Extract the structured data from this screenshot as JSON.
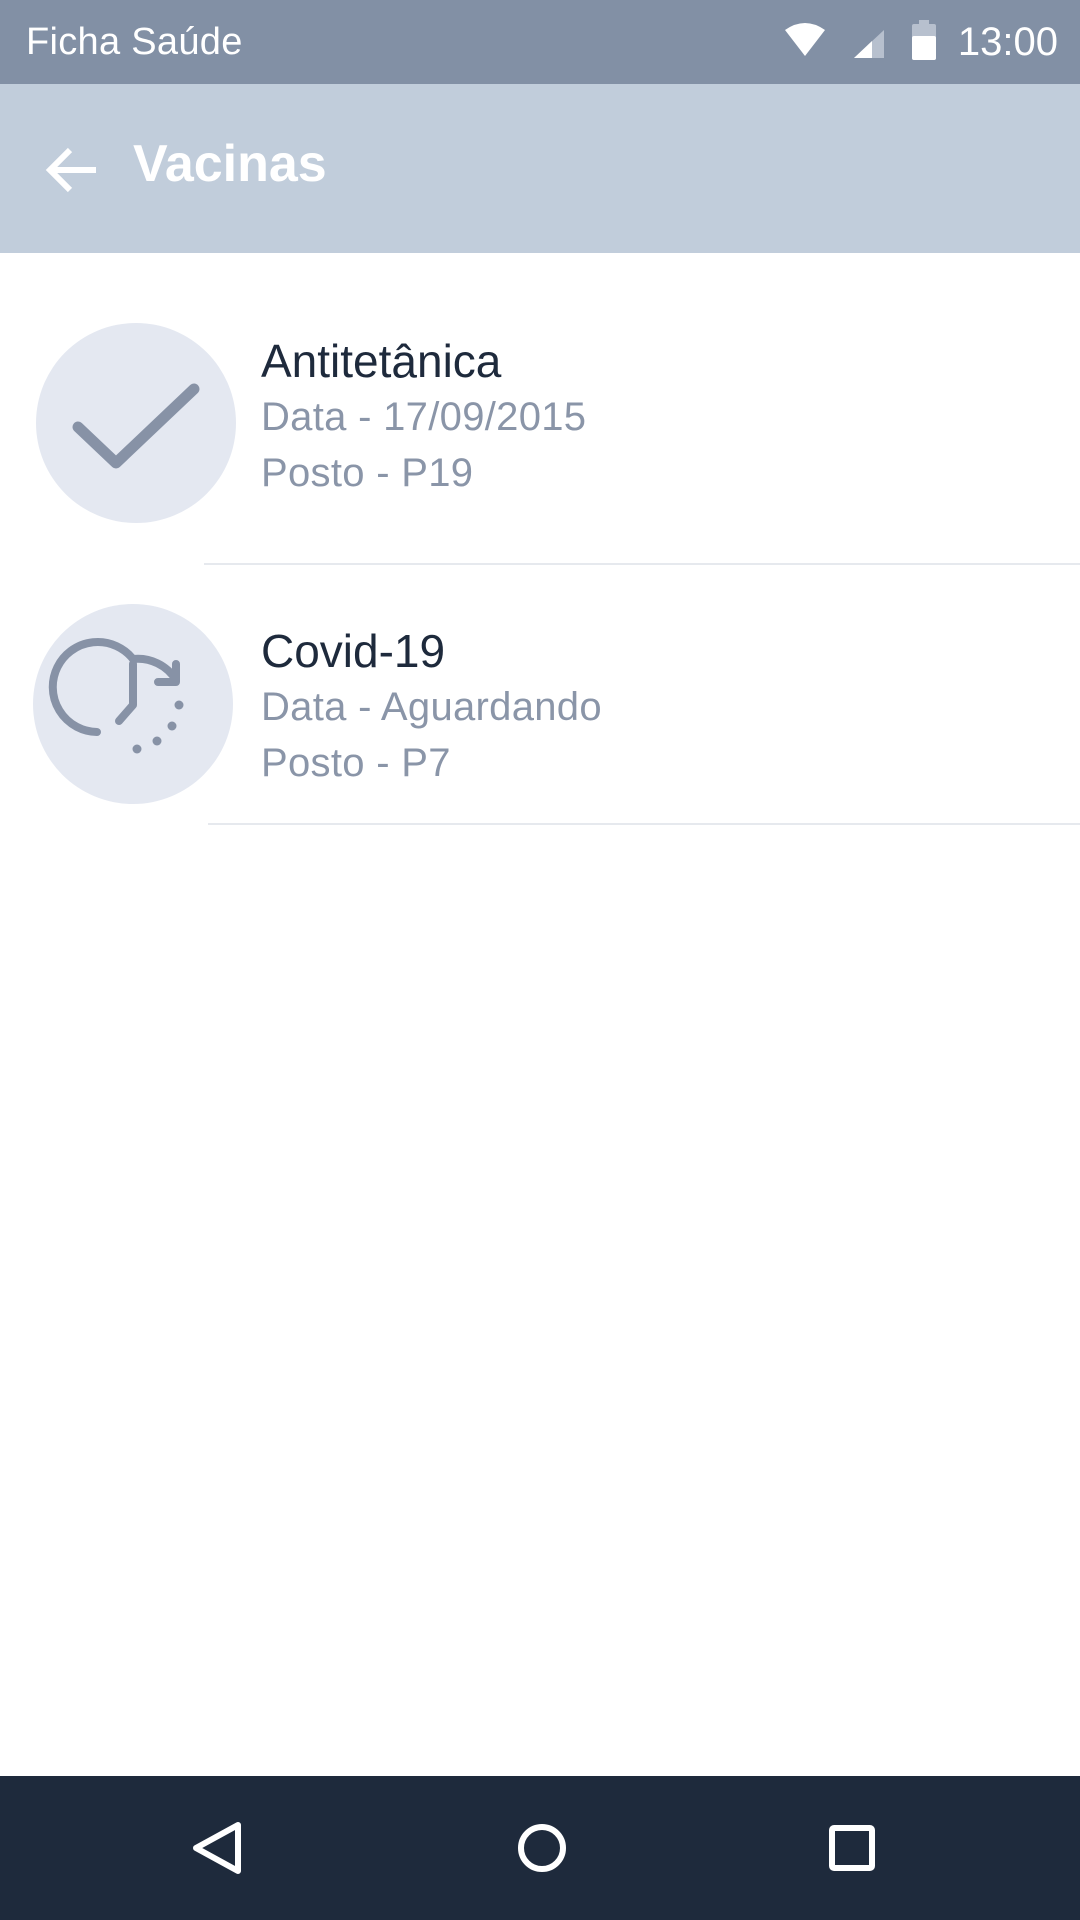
{
  "status_bar": {
    "app_name": "Ficha Saúde",
    "time": "13:00",
    "icons": [
      "wifi-icon",
      "signal-icon",
      "battery-icon"
    ],
    "background": "#8290a5"
  },
  "app_bar": {
    "title": "Vacinas",
    "back_icon": "arrow-left-icon",
    "background": "#c1cddb"
  },
  "vaccines": [
    {
      "name": "Antitetânica",
      "date": "Data - 17/09/2015",
      "post": "Posto - P19",
      "status_icon": "check-icon"
    },
    {
      "name": "Covid-19",
      "date": "Data - Aguardando",
      "post": "Posto - P7",
      "status_icon": "pending-clock-icon"
    }
  ],
  "nav_bar": {
    "buttons": [
      "back-triangle-icon",
      "home-circle-icon",
      "recents-square-icon"
    ],
    "background": "#1e2a3c"
  },
  "colors": {
    "title_text": "#1e2a3c",
    "secondary_text": "#8a95a8",
    "icon": "#8792a6",
    "avatar_bg": "#e4e8f1"
  }
}
